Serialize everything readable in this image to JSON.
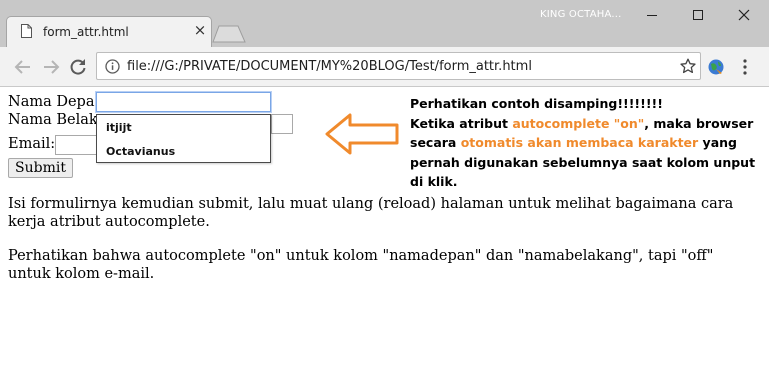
{
  "window": {
    "tab_title": "form_attr.html",
    "tab_close": "×",
    "profile_name": "KING OCTAHA..."
  },
  "toolbar": {
    "url": "file:///G:/PRIVATE/DOCUMENT/MY%20BLOG/Test/form_attr.html"
  },
  "form": {
    "label_nama_depan": "Nama Depan:",
    "label_nama_belakang": "Nama Belaka",
    "label_email": "Email:",
    "submit_label": "Submit",
    "nama_depan_value": "",
    "autocomplete_options": [
      "itjijt",
      "Octavianus"
    ]
  },
  "paragraphs": {
    "p1": "Isi formulirnya kemudian submit, lalu muat ulang (reload) halaman untuk melihat bagaimana cara kerja atribut autocomplete.",
    "p2": "Perhatikan bahwa autocomplete \"on\" untuk kolom \"namadepan\" dan \"namabelakang\", tapi \"off\" untuk kolom e-mail."
  },
  "annotation": {
    "line1": "Perhatikan contoh disamping!!!!!!!!",
    "part1": "Ketika atribut ",
    "highlight1": "autocomplete \"on\"",
    "part2": ", maka browser secara ",
    "highlight2": "otomatis akan membaca karakter",
    "part3": " yang pernah digunakan sebelumnya saat kolom unput di klik.",
    "accent_color": "#f08a2c"
  },
  "icons": {
    "tab": "page-icon",
    "back": "back-arrow-icon",
    "forward": "forward-arrow-icon",
    "reload": "reload-icon",
    "info": "info-icon",
    "star": "star-icon",
    "extension": "globe-extension-icon",
    "menu": "kebab-menu-icon"
  }
}
